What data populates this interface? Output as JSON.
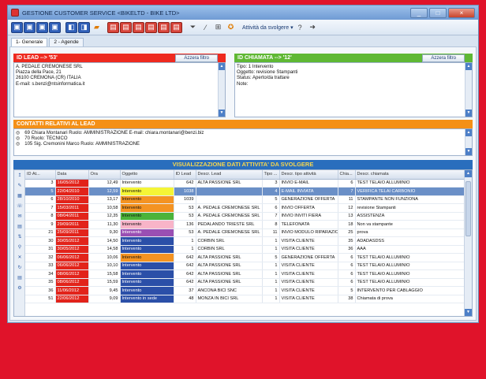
{
  "window": {
    "title": "GESTIONE CUSTOMER SERVICE <BIKELTD - BIKE LTD>",
    "buttons": [
      "_",
      "□",
      "×"
    ]
  },
  "toolbar": {
    "menu_label": "Attività da svolgere ▾"
  },
  "tabs": [
    {
      "label": "1- Generale",
      "active": true
    },
    {
      "label": "2 - Agende",
      "active": false
    }
  ],
  "lead": {
    "header": "ID LEAD --> '53'",
    "reset": "Azzera filtro",
    "lines": [
      "A. PEDALE CREMONESE SRL",
      "Piazza della Pace, 21",
      "26100 CREMONA (CR) ITALIA",
      "E-mail: s.benzi@ntsinformatica.it"
    ]
  },
  "chiamata": {
    "header": "ID CHIAMATA --> '12'",
    "reset": "Azzera filtro",
    "lines": [
      "Tipo: 1 Intervento",
      "Oggetto: revisione Stampanti",
      "Status: Aperto/da trattare",
      "Note:"
    ]
  },
  "contatti": {
    "header": "CONTATTI RELATIVI AL LEAD",
    "rows": [
      {
        "mark": "◎",
        "text": "69 Chiara  Montanari Ruolo: AMMINISTRAZIONE E-mail: chiara.montanari@benzi.biz"
      },
      {
        "mark": "◎",
        "text": "70  Ruolo: TECNICO"
      },
      {
        "mark": "◎",
        "text": "105 Sig.  Cremonini Marco Ruolo: AMMINISTRAZIONE"
      }
    ]
  },
  "attivita": {
    "header": "VISUALIZZAZIONE DATI ATTIVITA' DA SVOLGERE",
    "columns": [
      "ID At...",
      "Data",
      "Ora",
      "Oggetto",
      "ID Lead",
      "Descr. Lead",
      "Tipo ...",
      "Descr. tipo attività",
      "Chia...",
      "Descr. chiamata"
    ],
    "rows": [
      {
        "id": "3",
        "data": "16/05/2012",
        "ora": "12,49",
        "oggetto": "Intervento",
        "color": "#ffffff",
        "id_lead": "642",
        "lead": "ALTA PASSIONE SRL",
        "tipo": "3",
        "tipo_desc": "INVIO E-MAIL",
        "chia": "6",
        "chiamata": "TEST TELAIO ALLUMINIO"
      },
      {
        "id": "5",
        "data": "22/04/2010",
        "ora": "12,59",
        "oggetto": "Intervento",
        "color": "#f5f536",
        "id_lead": "1038",
        "lead": "",
        "tipo": "4",
        "tipo_desc": "E-MAIL INVIATA",
        "chia": "7",
        "chiamata": "VERIFICA TELAI CARBONIO",
        "selected": true
      },
      {
        "id": "6",
        "data": "28/10/2010",
        "ora": "13,17",
        "oggetto": "Intervento",
        "color": "#f49322",
        "id_lead": "1039",
        "lead": "",
        "tipo": "5",
        "tipo_desc": "GENERAZIONE OFFERTA",
        "chia": "11",
        "chiamata": "STAMPANTE NON FUNZIONA"
      },
      {
        "id": "7",
        "data": "15/03/2011",
        "ora": "10,58",
        "oggetto": "Intervento",
        "color": "#f49322",
        "id_lead": "53",
        "lead": "A. PEDALE CREMONESE SRL",
        "tipo": "6",
        "tipo_desc": "INVIO OFFERTA",
        "chia": "12",
        "chiamata": "revisione Stampanti"
      },
      {
        "id": "8",
        "data": "08/04/2011",
        "ora": "12,35",
        "oggetto": "Intervento",
        "color": "#4bb33a",
        "id_lead": "53",
        "lead": "A. PEDALE CREMONESE SRL",
        "tipo": "7",
        "tipo_desc": "INVIO INVITI FIERA",
        "chia": "13",
        "chiamata": "ASSISTENZA"
      },
      {
        "id": "9",
        "data": "29/09/2011",
        "ora": "11,30",
        "oggetto": "Intervento",
        "color": "#f8b4c8",
        "id_lead": "136",
        "lead": "PEDALANDO TRIESTE SRL",
        "tipo": "8",
        "tipo_desc": "TELEFONATA",
        "chia": "18",
        "chiamata": "Non va stampante"
      },
      {
        "id": "21",
        "data": "25/09/2011",
        "ora": "9,30",
        "oggetto": "Intervento",
        "color": "#9a4fb3",
        "id_lead": "53",
        "lead": "A. PEDALE CREMONESE SRL",
        "tipo": "11",
        "tipo_desc": "INVIO MODULO RIPARAZIONE",
        "chia": "25",
        "chiamata": "prova"
      },
      {
        "id": "30",
        "data": "30/05/2012",
        "ora": "14,50",
        "oggetto": "Intervento",
        "color": "#2b4fa8",
        "id_lead": "1",
        "lead": "CORBIN SRL",
        "tipo": "1",
        "tipo_desc": "VISITA CLIENTE",
        "chia": "35",
        "chiamata": "ADADASDSS"
      },
      {
        "id": "31",
        "data": "30/05/2012",
        "ora": "14,58",
        "oggetto": "Intervento",
        "color": "#2b4fa8",
        "id_lead": "1",
        "lead": "CORBIN SRL",
        "tipo": "1",
        "tipo_desc": "VISITA CLIENTE",
        "chia": "36",
        "chiamata": "AAA"
      },
      {
        "id": "32",
        "data": "06/06/2012",
        "ora": "10,06",
        "oggetto": "Intervento",
        "color": "#f49322",
        "id_lead": "642",
        "lead": "ALTA PASSIONE SRL",
        "tipo": "5",
        "tipo_desc": "GENERAZIONE OFFERTA",
        "chia": "6",
        "chiamata": "TEST TELAIO ALLUMINIO"
      },
      {
        "id": "33",
        "data": "06/06/2012",
        "ora": "10,10",
        "oggetto": "Intervento",
        "color": "#2b4fa8",
        "id_lead": "642",
        "lead": "ALTA PASSIONE SRL",
        "tipo": "1",
        "tipo_desc": "VISITA CLIENTE",
        "chia": "6",
        "chiamata": "TEST TELAIO ALLUMINIO"
      },
      {
        "id": "34",
        "data": "08/06/2012",
        "ora": "15,58",
        "oggetto": "Intervento",
        "color": "#2b4fa8",
        "id_lead": "642",
        "lead": "ALTA PASSIONE SRL",
        "tipo": "1",
        "tipo_desc": "VISITA CLIENTE",
        "chia": "6",
        "chiamata": "TEST TELAIO ALLUMINIO"
      },
      {
        "id": "35",
        "data": "08/06/2012",
        "ora": "15,59",
        "oggetto": "Intervento",
        "color": "#2b4fa8",
        "id_lead": "642",
        "lead": "ALTA PASSIONE SRL",
        "tipo": "1",
        "tipo_desc": "VISITA CLIENTE",
        "chia": "6",
        "chiamata": "TEST TELAIO ALLUMINIO"
      },
      {
        "id": "36",
        "data": "11/06/2012",
        "ora": "9,45",
        "oggetto": "Intervento",
        "color": "#2b4fa8",
        "id_lead": "37",
        "lead": "ANCONA BICI SNC",
        "tipo": "1",
        "tipo_desc": "VISITA CLIENTE",
        "chia": "5",
        "chiamata": "INTERVENTO PER CABLAGGIO"
      },
      {
        "id": "51",
        "data": "22/06/2012",
        "ora": "9,09",
        "oggetto": "Intervento in sede",
        "color": "#2b4fa8",
        "id_lead": "48",
        "lead": "MONZA IN BICI SRL",
        "tipo": "1",
        "tipo_desc": "VISITA CLIENTE",
        "chia": "38",
        "chiamata": "Chiamata di prova"
      }
    ]
  }
}
